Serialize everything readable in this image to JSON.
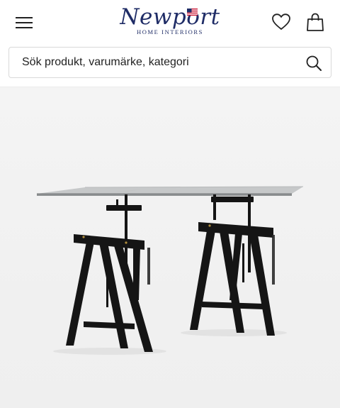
{
  "header": {
    "brand_name": "Newport",
    "brand_tagline": "HOME INTERIORS",
    "icons": {
      "menu": "hamburger-menu-icon",
      "favorites": "heart-icon",
      "cart": "shopping-bag-icon",
      "flag": "us-flag-icon"
    }
  },
  "search": {
    "placeholder": "Sök produkt, varumärke, kategori",
    "icon": "search-icon"
  },
  "product": {
    "image": "glass-top-trestle-desk",
    "colors": {
      "frame": "#151515",
      "glass": "#9a9d9e",
      "brand": "#1f2c66"
    }
  }
}
